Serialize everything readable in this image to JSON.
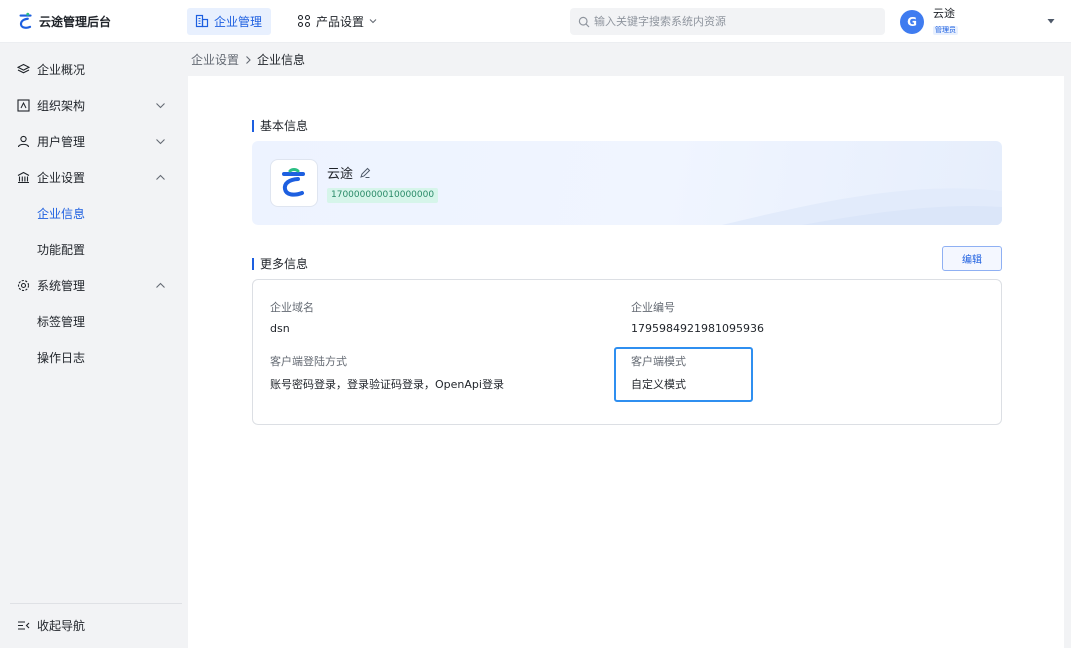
{
  "header": {
    "brand_title": "云途管理后台",
    "nav": [
      {
        "label": "企业管理",
        "icon": "building-icon",
        "active": true
      },
      {
        "label": "产品设置",
        "icon": "product-icon",
        "active": false
      }
    ],
    "search_placeholder": "输入关键字搜索系统内资源",
    "user": {
      "avatar_letter": "G",
      "name": "云途",
      "role": "管理员"
    }
  },
  "sidebar": {
    "items": [
      {
        "label": "企业概况",
        "icon": "layers-icon"
      },
      {
        "label": "组织架构",
        "icon": "org-chart-icon"
      },
      {
        "label": "用户管理",
        "icon": "user-icon"
      },
      {
        "label": "企业设置",
        "icon": "bank-icon"
      },
      {
        "label": "企业信息",
        "active": true
      },
      {
        "label": "功能配置"
      },
      {
        "label": "系统管理",
        "icon": "gear-icon"
      },
      {
        "label": "标签管理"
      },
      {
        "label": "操作日志"
      }
    ],
    "collapse_label": "收起导航"
  },
  "breadcrumb": {
    "parent": "企业设置",
    "current": "企业信息"
  },
  "basic_info": {
    "title": "基本信息",
    "company_name": "云途",
    "company_id": "170000000010000000"
  },
  "more_info": {
    "title": "更多信息",
    "edit_label": "编辑",
    "fields": [
      {
        "label": "企业域名",
        "value": "dsn"
      },
      {
        "label": "企业编号",
        "value": "1795984921981095936"
      },
      {
        "label": "客户端登陆方式",
        "value": "账号密码登录，登录验证码登录，OpenApi登录"
      },
      {
        "label": "客户端模式",
        "value": "自定义模式"
      }
    ]
  },
  "colors": {
    "accent": "#1d5fe0",
    "highlight": "#2f8ff0",
    "tag_bg": "#d6f5ea"
  }
}
